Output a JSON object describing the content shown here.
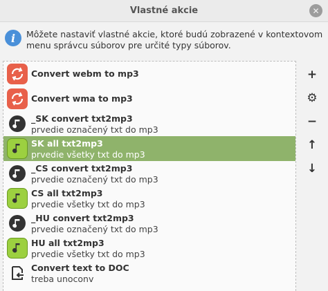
{
  "window": {
    "title": "Vlastné akcie",
    "close_icon": "close-icon"
  },
  "info": {
    "icon": "info-icon",
    "text": "Môžete nastaviť vlastné akcie, ktoré budú zobrazené v kontextovom menu správcu súborov pre určité typy súborov."
  },
  "actions": [
    {
      "icon": "convert-icon",
      "title": "Convert webm to mp3",
      "subtitle": ""
    },
    {
      "icon": "convert-icon",
      "title": "Convert wma to mp3",
      "subtitle": ""
    },
    {
      "icon": "music-note-icon",
      "title": "_SK convert txt2mp3",
      "subtitle": "prvedie označený txt do mp3"
    },
    {
      "icon": "music-note-green-icon",
      "title": "SK all txt2mp3",
      "subtitle": "prvedie všetky txt do mp3",
      "selected": true
    },
    {
      "icon": "music-note-icon",
      "title": "_CS convert txt2mp3",
      "subtitle": "prvedie označený txt do mp3"
    },
    {
      "icon": "music-note-green-icon",
      "title": "CS all txt2mp3",
      "subtitle": "prvedie všetky txt do mp3"
    },
    {
      "icon": "music-note-icon",
      "title": "_HU convert txt2mp3",
      "subtitle": "prvedie označený txt do mp3"
    },
    {
      "icon": "music-note-green-icon",
      "title": "HU all txt2mp3",
      "subtitle": "prvedie všetky txt do mp3"
    },
    {
      "icon": "document-export-icon",
      "title": "Convert text to DOC",
      "subtitle": "treba unoconv"
    }
  ],
  "toolbar": {
    "add": "+",
    "edit": "⚙",
    "remove": "−",
    "up": "↑",
    "down": "↓"
  },
  "colors": {
    "selection": "#8fb36b",
    "convert_icon_bg": "#e8604a",
    "note_icon_bg": "#9cd040",
    "info_icon_bg": "#4a90d9"
  }
}
